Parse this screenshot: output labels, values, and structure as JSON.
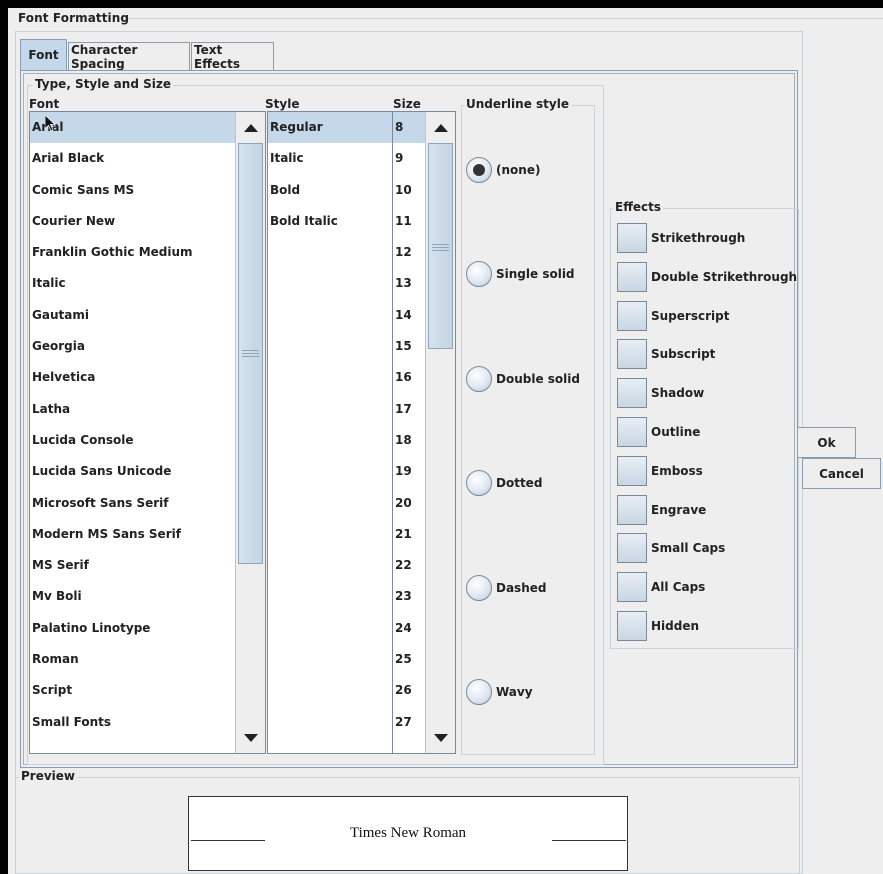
{
  "dialog": {
    "title": "Font Formatting"
  },
  "tabs": [
    {
      "label": "Font",
      "active": true
    },
    {
      "label": "Character Spacing",
      "active": false
    },
    {
      "label": "Text Effects",
      "active": false
    }
  ],
  "type_style_size": {
    "title": "Type, Style and Size",
    "font_label": "Font",
    "style_label": "Style",
    "size_label": "Size",
    "fonts": [
      "Arial",
      "Arial Black",
      "Comic Sans MS",
      "Courier New",
      "Franklin Gothic Medium",
      "Italic",
      "Gautami",
      "Georgia",
      "Helvetica",
      "Latha",
      "Lucida Console",
      "Lucida Sans Unicode",
      "Microsoft Sans Serif",
      "Modern MS Sans Serif",
      "MS Serif",
      "Mv Boli",
      "Palatino Linotype",
      "Roman",
      "Script",
      "Small Fonts"
    ],
    "selected_font": "Arial",
    "styles": [
      "Regular",
      "Italic",
      "Bold",
      "Bold Italic"
    ],
    "selected_style": "Regular",
    "sizes": [
      "8",
      "9",
      "10",
      "11",
      "12",
      "13",
      "14",
      "15",
      "16",
      "17",
      "18",
      "19",
      "20",
      "21",
      "22",
      "23",
      "24",
      "25",
      "26",
      "27"
    ],
    "selected_size": "8"
  },
  "underline": {
    "title": "Underline style",
    "options": [
      "(none)",
      "Single solid",
      "Double solid",
      "Dotted",
      "Dashed",
      "Wavy"
    ],
    "selected": "(none)"
  },
  "effects": {
    "title": "Effects",
    "options": [
      "Strikethrough",
      "Double Strikethrough",
      "Superscript",
      "Subscript",
      "Shadow",
      "Outline",
      "Emboss",
      "Engrave",
      "Small Caps",
      "All Caps",
      "Hidden"
    ]
  },
  "buttons": {
    "ok": "Ok",
    "cancel": "Cancel"
  },
  "preview": {
    "title": "Preview",
    "text": "Times New Roman"
  },
  "icons": {
    "scroll_up": "arrow-up-icon",
    "scroll_down": "arrow-down-icon",
    "cursor": "mouse-pointer-icon"
  },
  "colors": {
    "selection": "#c5d8ea",
    "background": "#eeeeee",
    "border": "#8a9db0"
  }
}
